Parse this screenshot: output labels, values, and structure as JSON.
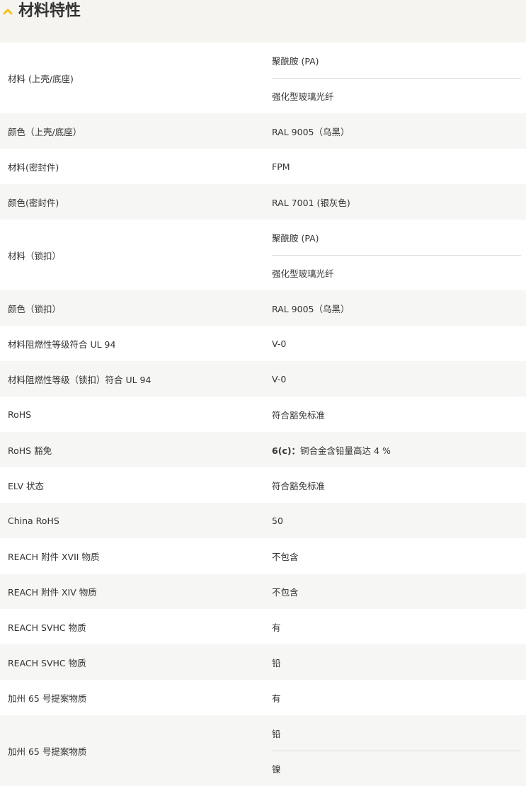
{
  "section": {
    "title": "材料特性",
    "toggle_icon": "chevron-up-icon",
    "accent_color": "#f2c21b"
  },
  "rows": [
    {
      "label": "材料 (上壳/底座)",
      "values": [
        "聚酰胺 (PA)",
        "强化型玻璃光纤"
      ]
    },
    {
      "label": "颜色（上壳/底座）",
      "values": [
        "RAL 9005（乌黑）"
      ]
    },
    {
      "label": "材料(密封件)",
      "values": [
        "FPM"
      ]
    },
    {
      "label": "颜色(密封件)",
      "values": [
        "RAL 7001 (银灰色)"
      ]
    },
    {
      "label": "材料（锁扣）",
      "values": [
        "聚酰胺 (PA)",
        "强化型玻璃光纤"
      ]
    },
    {
      "label": "颜色（锁扣）",
      "values": [
        "RAL 9005（乌黑）"
      ]
    },
    {
      "label": "材料阻燃性等级符合 UL 94",
      "values": [
        "V-0"
      ]
    },
    {
      "label": "材料阻燃性等级（锁扣）符合 UL 94",
      "values": [
        "V-0"
      ]
    },
    {
      "label": "RoHS",
      "values": [
        "符合豁免标准"
      ]
    },
    {
      "label": "RoHS 豁免",
      "values": [],
      "exemption": {
        "code": "6(c)：",
        "text": "铜合金含铅量高达 4 %"
      }
    },
    {
      "label": "ELV 状态",
      "values": [
        "符合豁免标准"
      ]
    },
    {
      "label": "China RoHS",
      "values": [
        "50"
      ]
    },
    {
      "label": "REACH 附件 XVII 物质",
      "values": [
        "不包含"
      ]
    },
    {
      "label": "REACH 附件 XIV 物质",
      "values": [
        "不包含"
      ]
    },
    {
      "label": "REACH SVHC 物质",
      "values": [
        "有"
      ]
    },
    {
      "label": "REACH SVHC 物质",
      "values": [
        "铅"
      ]
    },
    {
      "label": "加州 65 号提案物质",
      "values": [
        "有"
      ]
    },
    {
      "label": "加州 65 号提案物质",
      "values": [
        "铅",
        "镍"
      ]
    }
  ]
}
